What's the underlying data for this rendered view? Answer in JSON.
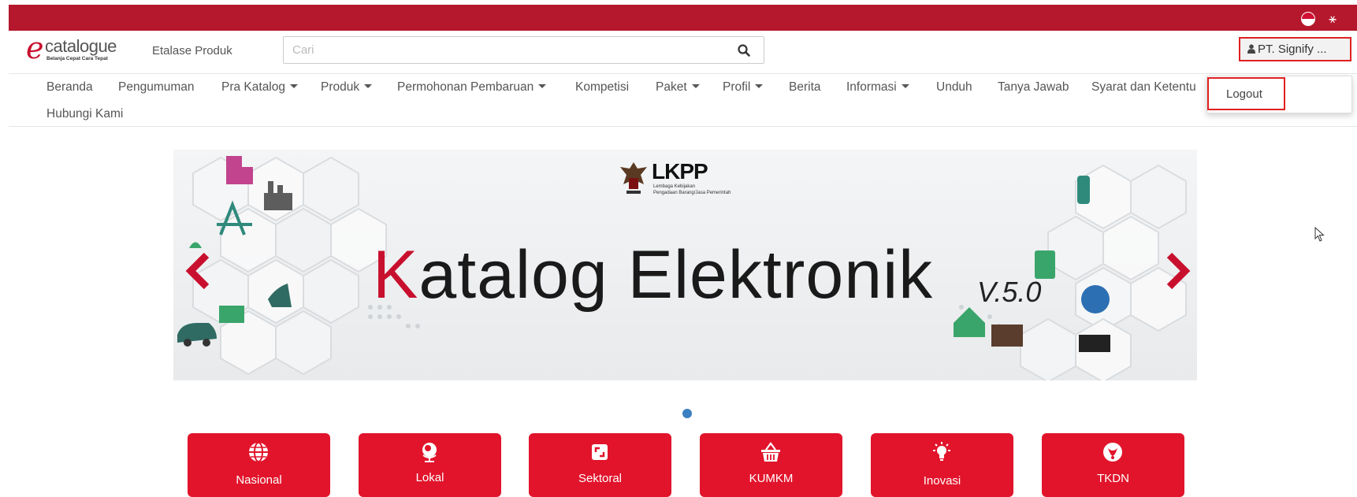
{
  "topbar": {
    "flag_id_icon": "indonesia-flag-icon",
    "flag_en_icon": "uk-flag-icon",
    "flag_en_glyph": "⚹",
    "color": "#b5172c"
  },
  "header": {
    "logo_e": "e",
    "logo_word": "catalogue",
    "logo_tag": "Belanja Cepat Cara Tepat",
    "etalase_label": "Etalase Produk",
    "search_placeholder": "Cari",
    "user_label": "PT. Signify ..."
  },
  "nav": {
    "row1": [
      {
        "label": "Beranda",
        "caret": false
      },
      {
        "label": "Pengumuman",
        "caret": false
      },
      {
        "label": "Pra Katalog",
        "caret": true
      },
      {
        "label": "Produk",
        "caret": true
      },
      {
        "label": "Permohonan Pembaruan",
        "caret": true
      },
      {
        "label": "Kompetisi",
        "caret": false
      },
      {
        "label": "Paket",
        "caret": true
      },
      {
        "label": "Profil",
        "caret": true
      },
      {
        "label": "Berita",
        "caret": false
      },
      {
        "label": "Informasi",
        "caret": true
      },
      {
        "label": "Unduh",
        "caret": false
      },
      {
        "label": "Tanya Jawab",
        "caret": false
      },
      {
        "label": "Syarat dan Ketentu",
        "caret": false
      }
    ],
    "row2": [
      {
        "label": "Hubungi Kami",
        "caret": false
      }
    ]
  },
  "dropdown": {
    "logout_label": "Logout"
  },
  "banner": {
    "lkpp_logo": "LKPP",
    "lkpp_line1": "Lembaga Kebijakan",
    "lkpp_line2": "Pengadaan Barang/Jasa Pemerintah",
    "title_first": "K",
    "title_rest": "atalog Elektronik",
    "version": "V.5.0",
    "accent_color": "#c8102e"
  },
  "tiles": [
    {
      "label": "Nasional",
      "icon": "globe-icon"
    },
    {
      "label": "Lokal",
      "icon": "desk-globe-icon"
    },
    {
      "label": "Sektoral",
      "icon": "expand-icon"
    },
    {
      "label": "KUMKM",
      "icon": "basket-icon"
    },
    {
      "label": "Inovasi",
      "icon": "lightbulb-icon"
    },
    {
      "label": "TKDN",
      "icon": "tkdn-logo-icon"
    }
  ],
  "colors": {
    "tile": "#e1142b",
    "carousel_dot": "#3a7fc1"
  }
}
